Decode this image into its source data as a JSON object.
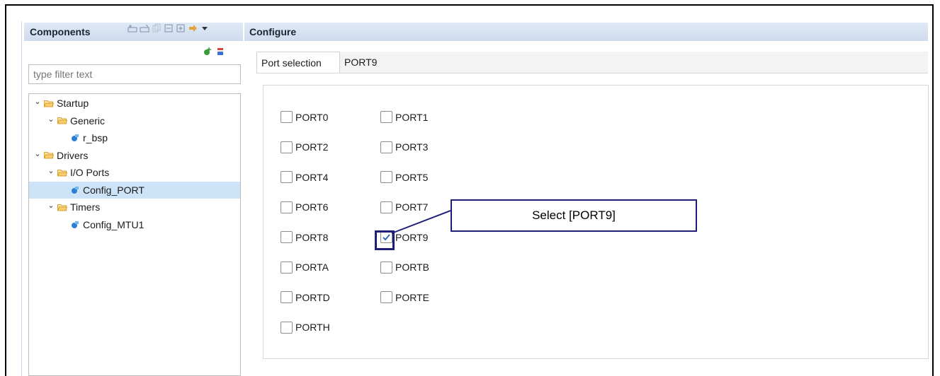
{
  "components": {
    "title": "Components",
    "filter_placeholder": "type filter text",
    "tree": [
      {
        "label": "Startup",
        "level": 0,
        "kind": "folder",
        "expanded": true
      },
      {
        "label": "Generic",
        "level": 1,
        "kind": "folder",
        "expanded": true
      },
      {
        "label": "r_bsp",
        "level": 2,
        "kind": "leaf"
      },
      {
        "label": "Drivers",
        "level": 0,
        "kind": "folder",
        "expanded": true
      },
      {
        "label": "I/O Ports",
        "level": 1,
        "kind": "folder",
        "expanded": true
      },
      {
        "label": "Config_PORT",
        "level": 2,
        "kind": "leaf",
        "selected": true
      },
      {
        "label": "Timers",
        "level": 1,
        "kind": "folder",
        "expanded": true
      },
      {
        "label": "Config_MTU1",
        "level": 2,
        "kind": "leaf"
      }
    ]
  },
  "configure": {
    "title": "Configure",
    "tabs": [
      {
        "label": "Port selection",
        "active": true
      },
      {
        "label": "PORT9",
        "active": false
      }
    ],
    "ports": [
      {
        "label": "PORT0",
        "checked": false
      },
      {
        "label": "PORT1",
        "checked": false
      },
      {
        "label": "PORT2",
        "checked": false
      },
      {
        "label": "PORT3",
        "checked": false
      },
      {
        "label": "PORT4",
        "checked": false
      },
      {
        "label": "PORT5",
        "checked": false
      },
      {
        "label": "PORT6",
        "checked": false
      },
      {
        "label": "PORT7",
        "checked": false
      },
      {
        "label": "PORT8",
        "checked": false
      },
      {
        "label": "PORT9",
        "checked": true
      },
      {
        "label": "PORTA",
        "checked": false
      },
      {
        "label": "PORTB",
        "checked": false
      },
      {
        "label": "PORTD",
        "checked": false
      },
      {
        "label": "PORTE",
        "checked": false
      },
      {
        "label": "PORTH",
        "checked": false
      }
    ]
  },
  "annotation": {
    "callout_text": "Select [PORT9]"
  },
  "colors": {
    "header_bg": "#d6e2f2",
    "selection_bg": "#cde3f7",
    "annotation_border": "#1f1f7a",
    "folder": "#e8b64c",
    "leaf_icon": "#2a7fd4"
  }
}
